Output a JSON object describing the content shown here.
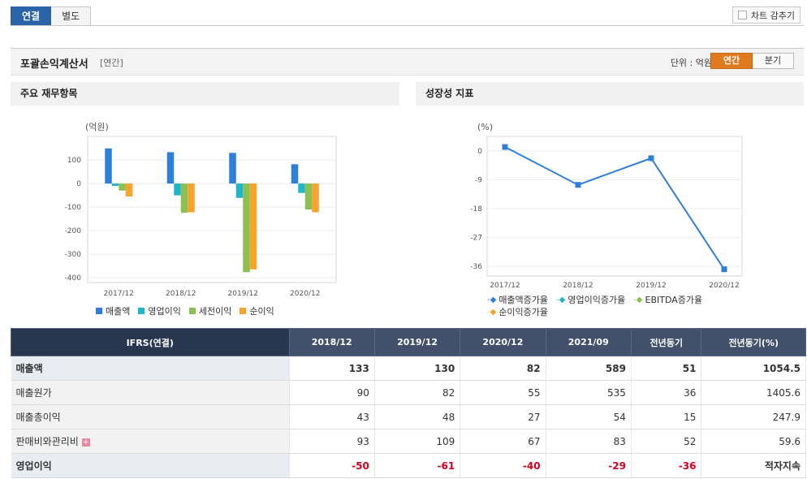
{
  "top_tabs": [
    "연결",
    "별도"
  ],
  "hide_chart_label": "차트 감추기",
  "title": {
    "main": "포괄손익계산서",
    "sub": "[연간]",
    "unit": "단위 : 억원"
  },
  "period_tabs": [
    "연간",
    "분기"
  ],
  "sections": {
    "left": "주요 재무항목",
    "right": "성장성 지표"
  },
  "chart_data": [
    {
      "type": "bar",
      "ylabel": "(억원)",
      "categories": [
        "2017/12",
        "2018/12",
        "2019/12",
        "2020/12"
      ],
      "ylim": [
        -420,
        200
      ],
      "yticks": [
        100,
        0,
        -100,
        -200,
        -300,
        -400
      ],
      "series": [
        {
          "name": "매출액",
          "color": "#2d7fd9",
          "values": [
            149,
            133,
            130,
            82
          ]
        },
        {
          "name": "영업이익",
          "color": "#1fb6c9",
          "values": [
            -10,
            -50,
            -61,
            -40
          ]
        },
        {
          "name": "세전이익",
          "color": "#8cc152",
          "values": [
            -30,
            -124,
            -376,
            -110
          ]
        },
        {
          "name": "순이익",
          "color": "#f6a42b",
          "values": [
            -55,
            -122,
            -364,
            -122
          ]
        }
      ]
    },
    {
      "type": "line",
      "ylabel": "(%)",
      "categories": [
        "2017/12",
        "2018/12",
        "2019/12",
        "2020/12"
      ],
      "ylim": [
        -39,
        4.5
      ],
      "yticks": [
        0,
        -9,
        -18,
        -27,
        -36
      ],
      "series": [
        {
          "name": "매출액증가율",
          "color": "#2d7fd9",
          "values": [
            1.2,
            -10.6,
            -2.3,
            -36.9
          ]
        },
        {
          "name": "영업이익증가율",
          "color": "#1fb6c9",
          "values": []
        },
        {
          "name": "EBITDA증가율",
          "color": "#8cc152",
          "values": []
        },
        {
          "name": "순이익증가율",
          "color": "#f6a42b",
          "values": []
        }
      ]
    }
  ],
  "table": {
    "header_first": "IFRS(연결)",
    "headers": [
      "2018/12",
      "2019/12",
      "2020/12",
      "2021/09",
      "전년동기",
      "전년동기(%)"
    ],
    "rows": [
      {
        "label": "매출액",
        "bold": true,
        "values": [
          "133",
          "130",
          "82",
          "589",
          "51",
          "1054.5"
        ]
      },
      {
        "label": "매출원가",
        "bold": false,
        "values": [
          "90",
          "82",
          "55",
          "535",
          "36",
          "1405.6"
        ]
      },
      {
        "label": "매출총이익",
        "bold": false,
        "values": [
          "43",
          "48",
          "27",
          "54",
          "15",
          "247.9"
        ]
      },
      {
        "label": "판매비와관리비",
        "bold": false,
        "expand": true,
        "values": [
          "93",
          "109",
          "67",
          "83",
          "52",
          "59.6"
        ]
      },
      {
        "label": "영업이익",
        "bold": true,
        "values": [
          "-50",
          "-61",
          "-40",
          "-29",
          "-36",
          "적자지속"
        ]
      }
    ]
  }
}
